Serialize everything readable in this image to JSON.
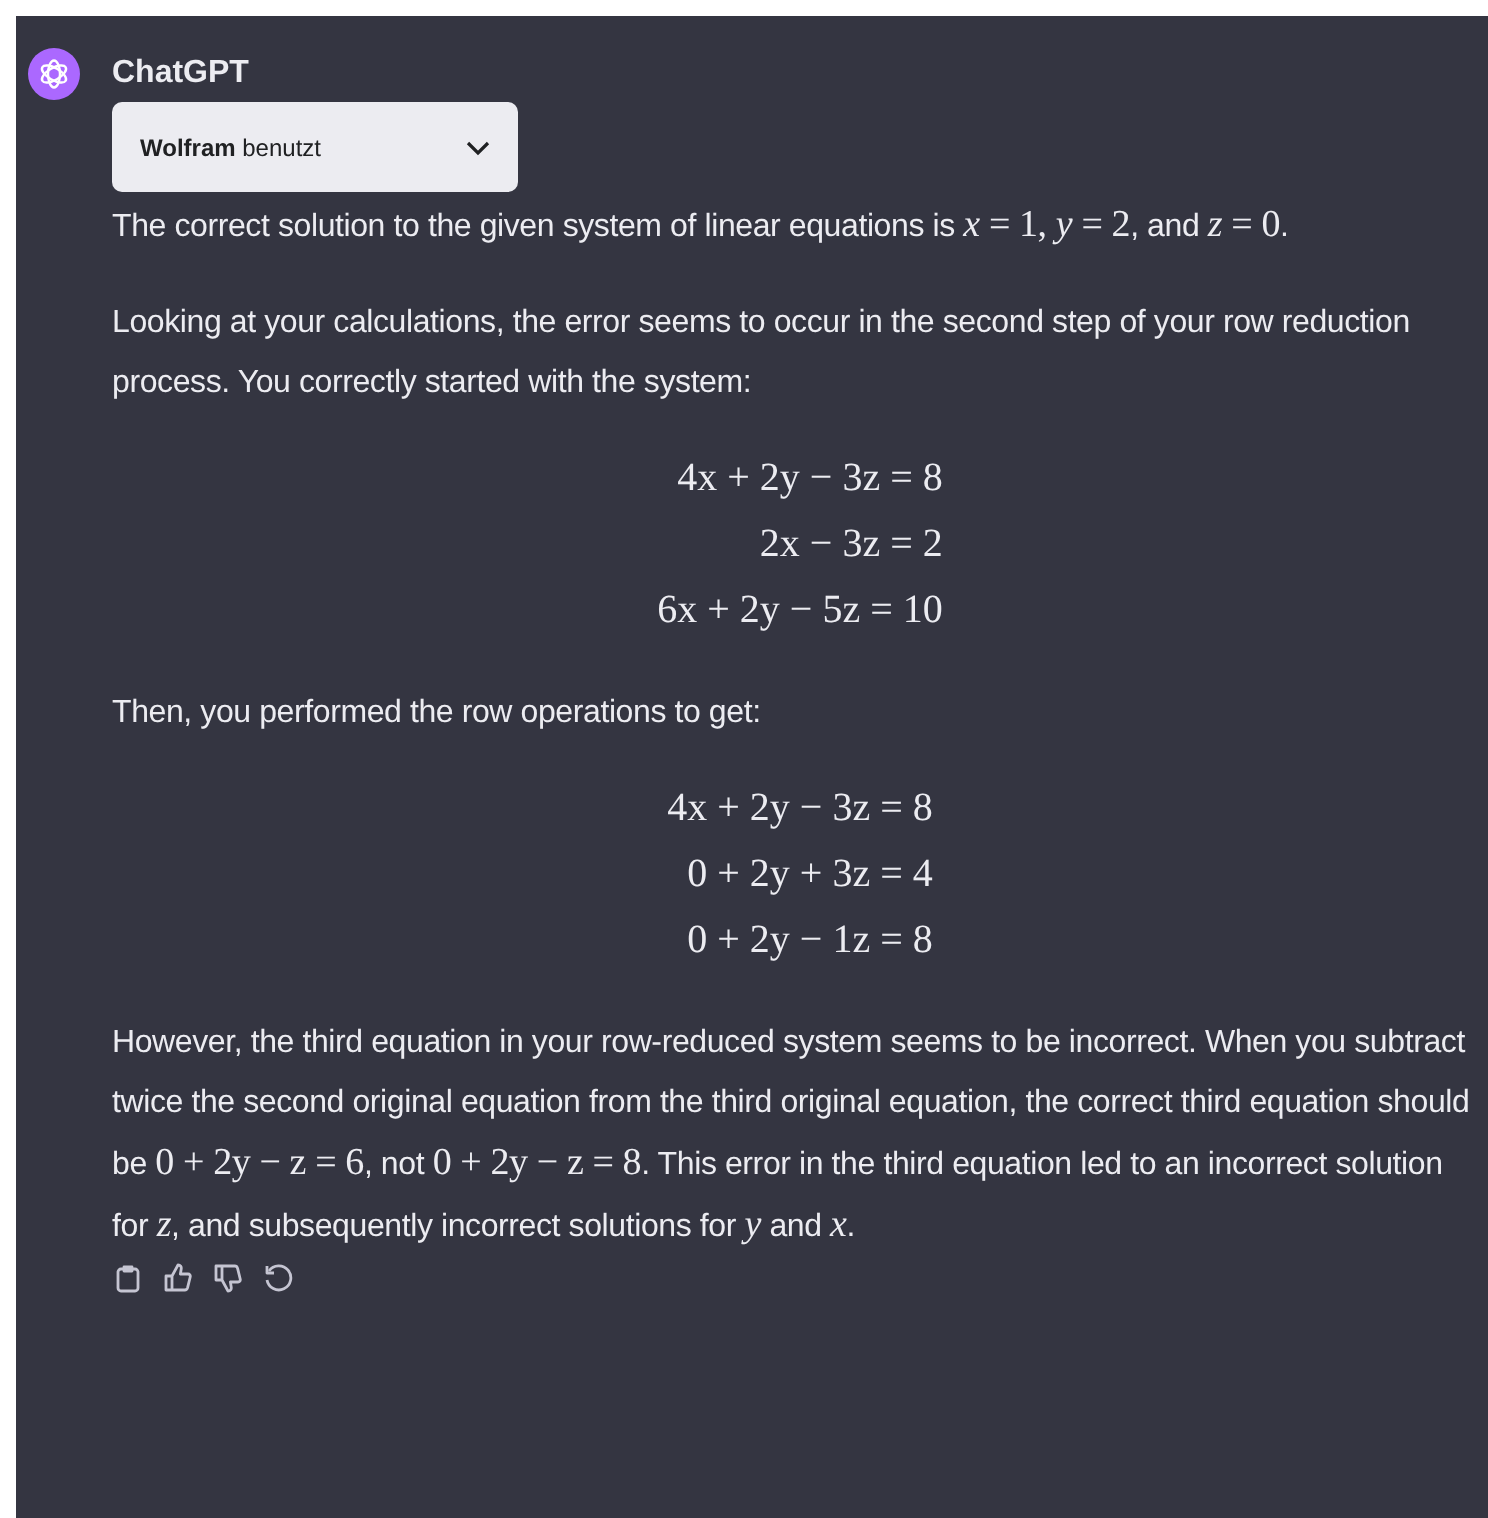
{
  "message": {
    "author": "ChatGPT",
    "plugin": {
      "name": "Wolfram",
      "suffix": "benutzt",
      "expanded": false
    },
    "blocks": [
      {
        "kind": "paragraph",
        "segments": [
          {
            "kind": "text",
            "text": "The correct solution to the given system of linear equations is "
          },
          {
            "kind": "math",
            "text": "*x* = 1, *y* = 2"
          },
          {
            "kind": "text",
            "text": ", and "
          },
          {
            "kind": "math",
            "text": "*z* = 0"
          },
          {
            "kind": "text",
            "text": "."
          }
        ]
      },
      {
        "kind": "paragraph",
        "segments": [
          {
            "kind": "text",
            "text": "Looking at your calculations, the error seems to occur in the second step of your row reduction process. You correctly started with the system:"
          }
        ]
      },
      {
        "kind": "equations",
        "lines": [
          "4x + 2y − 3z = 8",
          "2x − 3z = 2",
          "6x + 2y − 5z = 10"
        ]
      },
      {
        "kind": "paragraph",
        "segments": [
          {
            "kind": "text",
            "text": "Then, you performed the row operations to get:"
          }
        ]
      },
      {
        "kind": "equations",
        "lines": [
          "4x + 2y − 3z = 8",
          "0 + 2y + 3z = 4",
          "0 + 2y − 1z = 8"
        ]
      },
      {
        "kind": "paragraph",
        "segments": [
          {
            "kind": "text",
            "text": "However, the third equation in your row-reduced system seems to be incorrect. When you subtract twice the second original equation from the third original equation, the correct third equation should be "
          },
          {
            "kind": "math",
            "text": "0 + 2y − z = 6"
          },
          {
            "kind": "text",
            "text": ", not "
          },
          {
            "kind": "math",
            "text": "0 + 2y − z = 8"
          },
          {
            "kind": "text",
            "text": ". This error in the third equation led to an incorrect solution for "
          },
          {
            "kind": "math",
            "text": "*z*"
          },
          {
            "kind": "text",
            "text": ", and subsequently incorrect solutions for "
          },
          {
            "kind": "math",
            "text": "*y*"
          },
          {
            "kind": "text",
            "text": " and "
          },
          {
            "kind": "math",
            "text": "*x*"
          },
          {
            "kind": "text",
            "text": "."
          }
        ]
      }
    ],
    "actions": [
      {
        "kind": "copy"
      },
      {
        "kind": "thumbs-up"
      },
      {
        "kind": "thumbs-down"
      },
      {
        "kind": "regenerate"
      }
    ]
  }
}
